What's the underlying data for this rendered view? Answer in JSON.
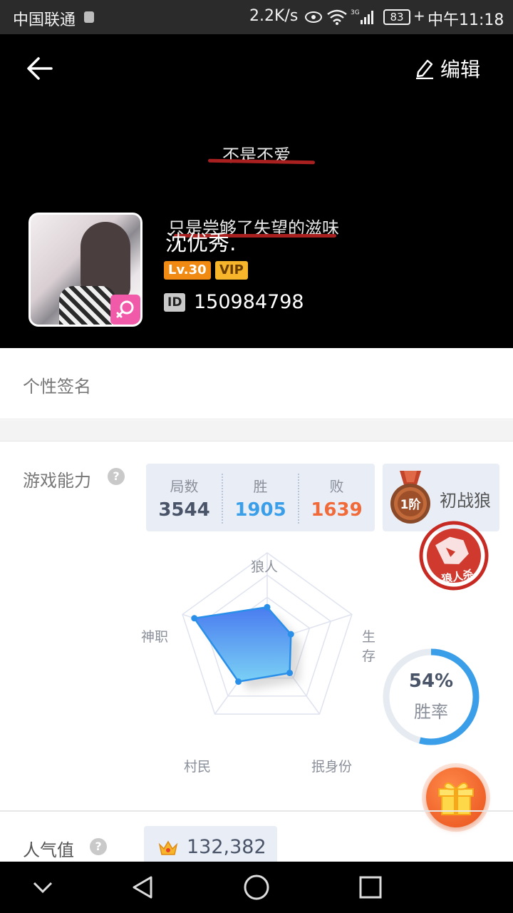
{
  "status_bar": {
    "carrier": "中国联通",
    "net_speed": "2.2K/s",
    "network": "3G",
    "battery": "83",
    "time": "中午11:18"
  },
  "header": {
    "edit_label": "编辑",
    "bg_text_line1": "不是不爱",
    "bg_text_line2": "只是尝够了失望的滋味",
    "nickname": "沈优秀.",
    "level": "Lv.30",
    "vip": "VIP",
    "id_label": "ID",
    "id_value": "150984798"
  },
  "signature": {
    "label": "个性签名"
  },
  "ability": {
    "label": "游戏能力",
    "help": "?",
    "stats": [
      {
        "caption": "局数",
        "value": "3544",
        "color": "#4a5468"
      },
      {
        "caption": "胜",
        "value": "1905",
        "color": "#3a9ee8"
      },
      {
        "caption": "败",
        "value": "1639",
        "color": "#f06a3a"
      }
    ],
    "rank_tier": "1阶",
    "rank_name": "初战狼",
    "stamp_text": "狼人杀",
    "radar": {
      "axes": [
        "狼人",
        "生存",
        "抿身份",
        "村民",
        "神职"
      ],
      "values": [
        0.39,
        0.28,
        0.43,
        0.55,
        0.86
      ]
    },
    "win_rate_value": 0.54,
    "win_rate_pct": "54%",
    "win_rate_label": "胜率"
  },
  "popularity": {
    "label": "人气值",
    "help": "?",
    "value": "132,382"
  },
  "colors": {
    "accent_blue": "#3a9ee8",
    "loss_orange": "#f06a3a",
    "level_orange": "#f08a12",
    "vip_gold": "#f7b52b",
    "gender_pink": "#f15aa8"
  }
}
